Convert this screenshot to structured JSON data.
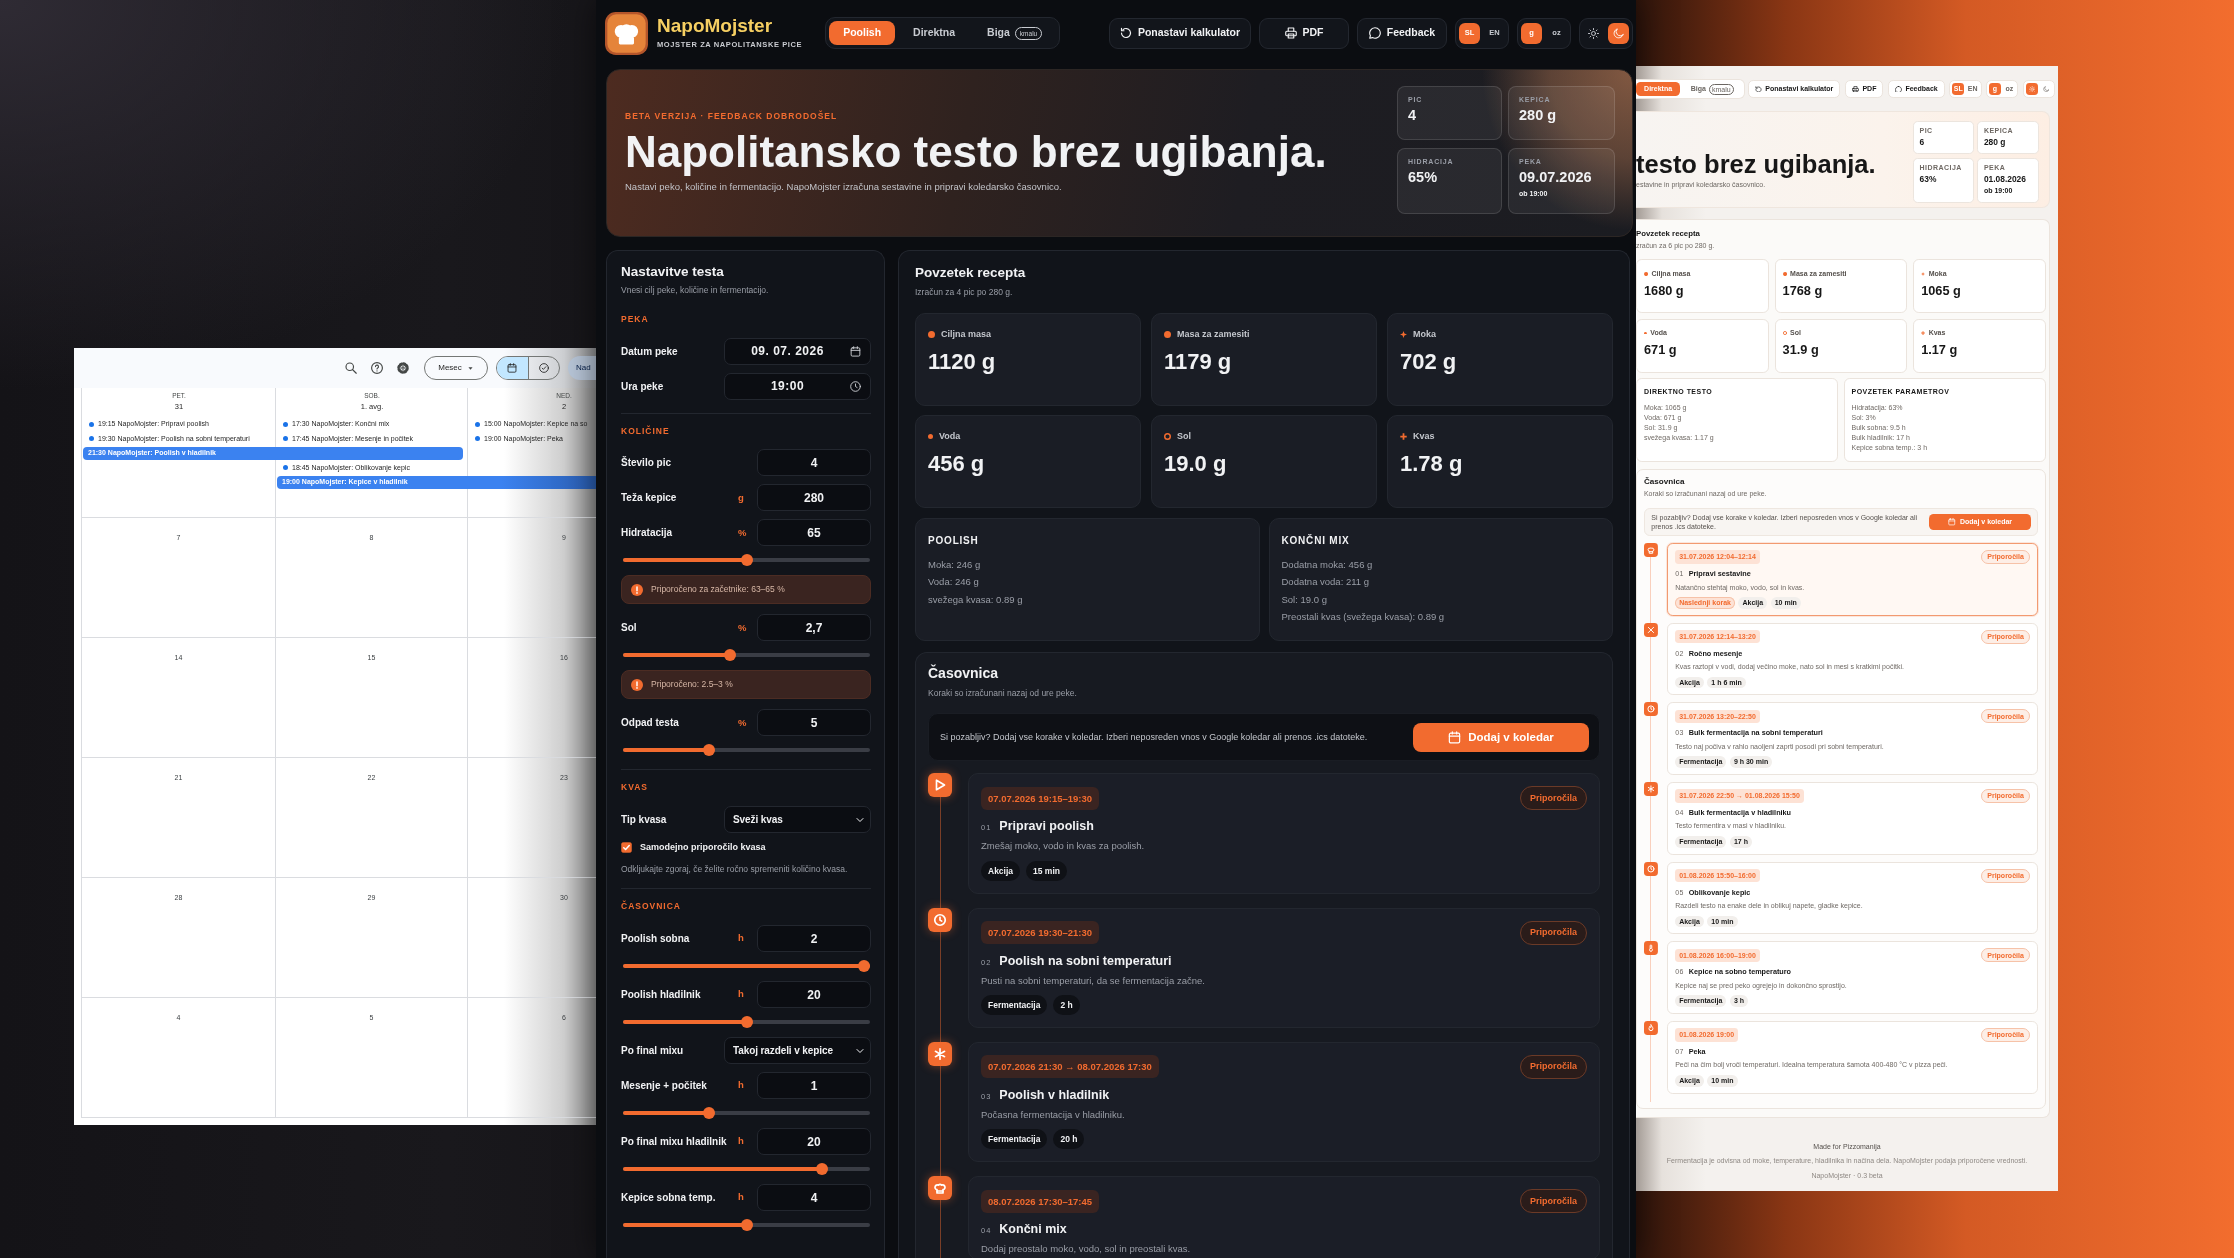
{
  "calendar": {
    "toolbar": {
      "view": "Mesec",
      "modes": [
        {
          "kind": "calendar",
          "selected": true
        },
        {
          "kind": "tasks",
          "selected": false
        }
      ],
      "account_button": "Nad"
    },
    "days": [
      {
        "weekday": "PET.",
        "date": "31",
        "events": [
          {
            "kind": "timed",
            "text": "19:15 NapoMojster: Pripravi poolish"
          },
          {
            "kind": "timed",
            "text": "19:30 NapoMojster: Poolish na sobni temperaturi"
          },
          {
            "kind": "overnight",
            "text": "21:30 NapoMojster: Poolish v hladilnik"
          }
        ]
      },
      {
        "weekday": "SOB.",
        "date": "1. avg.",
        "events": [
          {
            "kind": "timed",
            "text": "17:30 NapoMojster: Končni mix"
          },
          {
            "kind": "timed",
            "text": "17:45 NapoMojster: Mesenje in počitek"
          },
          {
            "kind": "timed",
            "text": "18:45 NapoMojster: Oblikovanje kepic"
          },
          {
            "kind": "overnight",
            "text": "19:00 NapoMojster: Kepice v hladilnik"
          }
        ]
      },
      {
        "weekday": "NED.",
        "date": "2",
        "events": [
          {
            "kind": "timed",
            "text": "15:00 NapoMojster: Kepice na so"
          },
          {
            "kind": "timed",
            "text": "19:00 NapoMojster: Peka"
          }
        ]
      }
    ],
    "weeks": [
      [
        "7",
        "8",
        "9"
      ],
      [
        "14",
        "15",
        "16"
      ],
      [
        "21",
        "22",
        "23"
      ],
      [
        "28",
        "29",
        "30"
      ],
      [
        "4",
        "5",
        "6"
      ]
    ]
  },
  "dark_app": {
    "brand": {
      "name": "NapoMojster",
      "tagline": "MOJSTER ZA NAPOLITANSKE PICE"
    },
    "method_tabs": [
      {
        "label": "Poolish",
        "selected": true
      },
      {
        "label": "Direktna",
        "selected": false
      },
      {
        "label": "Biga",
        "badge": "kmalu",
        "selected": false
      }
    ],
    "actions": [
      {
        "kind": "reset",
        "label": "Ponastavi kalkulator"
      },
      {
        "kind": "print",
        "label": "PDF"
      },
      {
        "kind": "feedback",
        "label": "Feedback"
      }
    ],
    "languages": [
      {
        "label": "SL",
        "selected": true
      },
      {
        "label": "EN",
        "selected": false
      }
    ],
    "units": [
      {
        "label": "g",
        "selected": true
      },
      {
        "label": "oz",
        "selected": false
      }
    ],
    "themes": [
      {
        "kind": "light",
        "selected": false
      },
      {
        "kind": "dark",
        "selected": true
      }
    ],
    "hero": {
      "eyebrow": "BETA VERZIJA · FEEDBACK DOBRODOŠEL",
      "title": "Napolitansko testo brez ugibanja.",
      "subtitle": "Nastavi peko, količine in fermentacijo. NapoMojster izračuna sestavine in pripravi koledarsko časovnico.",
      "stats": [
        {
          "label": "PIC",
          "value": "4"
        },
        {
          "label": "KEPICA",
          "value": "280 g"
        },
        {
          "label": "HIDRACIJA",
          "value": "65%"
        },
        {
          "label": "PEKA",
          "value": "09.07.2026",
          "note": "ob 19:00"
        }
      ]
    },
    "settings": {
      "title": "Nastavitve testa",
      "subtitle": "Vnesi cilj peke, količine in fermentacijo.",
      "sections": [
        {
          "heading": "PEKA",
          "items": [
            {
              "kind": "date",
              "label": "Datum peke",
              "value": "09. 07. 2026"
            },
            {
              "kind": "time",
              "label": "Ura peke",
              "value": "19:00"
            }
          ]
        },
        {
          "heading": "KOLIČINE",
          "items": [
            {
              "kind": "number",
              "label": "Število pic",
              "value": "4"
            },
            {
              "kind": "number",
              "label": "Teža kepice",
              "unit": "g",
              "value": "280"
            },
            {
              "kind": "number",
              "label": "Hidratacija",
              "unit": "%",
              "value": "65",
              "level": 0.5
            },
            {
              "kind": "note",
              "text": "Priporočeno za začetnike: 63–65 %"
            },
            {
              "kind": "number",
              "label": "Sol",
              "unit": "%",
              "value": "2,7",
              "level": 0.43
            },
            {
              "kind": "note",
              "text": "Priporočeno: 2.5–3 %"
            },
            {
              "kind": "number",
              "label": "Odpad testa",
              "unit": "%",
              "value": "5",
              "level": 0.34
            }
          ]
        },
        {
          "heading": "KVAS",
          "items": [
            {
              "kind": "select",
              "label": "Tip kvasa",
              "value": "Sveži kvas"
            },
            {
              "kind": "checkbox",
              "label": "Samodejno priporočilo kvasa",
              "checked": true
            },
            {
              "kind": "help",
              "text": "Odkljukajte zgoraj, če želite ročno spremeniti količino kvasa."
            }
          ]
        },
        {
          "heading": "ČASOVNICA",
          "items": [
            {
              "kind": "number",
              "label": "Poolish sobna",
              "unit": "h",
              "value": "2",
              "level": 1
            },
            {
              "kind": "number",
              "label": "Poolish hladilnik",
              "unit": "h",
              "value": "20",
              "level": 0.5
            },
            {
              "kind": "select",
              "label": "Po final mixu",
              "value": "Takoj razdeli v kepice"
            },
            {
              "kind": "number",
              "label": "Mesenje + počitek",
              "unit": "h",
              "value": "1",
              "level": 0.34
            },
            {
              "kind": "number",
              "label": "Po final mixu hladilnik",
              "unit": "h",
              "value": "20",
              "level": 0.82
            },
            {
              "kind": "number",
              "label": "Kepice sobna temp.",
              "unit": "h",
              "value": "4",
              "level": 0.5
            }
          ]
        }
      ]
    },
    "summary": {
      "title": "Povzetek recepta",
      "subtitle": "Izračun za 4 pic po 280 g.",
      "tiles": [
        {
          "kind": "target",
          "label": "Ciljna masa",
          "value": "1120 g"
        },
        {
          "kind": "dough",
          "label": "Masa za zamesiti",
          "value": "1179 g"
        },
        {
          "kind": "flour",
          "label": "Moka",
          "value": "702 g"
        },
        {
          "kind": "water",
          "label": "Voda",
          "value": "456 g"
        },
        {
          "kind": "salt",
          "label": "Sol",
          "value": "19.0 g"
        },
        {
          "kind": "yeast",
          "label": "Kvas",
          "value": "1.78 g"
        }
      ],
      "parts": [
        {
          "title": "POOLISH",
          "lines": [
            "Moka: 246 g",
            "Voda: 246 g",
            "svežega kvasa: 0.89 g"
          ]
        },
        {
          "title": "KONČNI MIX",
          "lines": [
            "Dodatna moka: 456 g",
            "Dodatna voda: 211 g",
            "Sol: 19.0 g",
            "Preostali kvas (svežega kvasa): 0.89 g"
          ]
        }
      ]
    },
    "timeline": {
      "title": "Časovnica",
      "subtitle": "Koraki so izračunani nazaj od ure peke.",
      "banner": "Si pozabljiv? Dodaj vse korake v koledar. Izberi neposreden vnos v Google koledar ali prenos .ics datoteke.",
      "button": "Dodaj v koledar",
      "steps": [
        {
          "kind": "start",
          "time": "07.07.2026 19:15–19:30",
          "number": "01",
          "title": "Pripravi poolish",
          "description": "Zmešaj moko, vodo in kvas za poolish.",
          "tags": [
            "Akcija",
            "15 min"
          ],
          "tip": "Priporočila",
          "current": false
        },
        {
          "kind": "clock",
          "time": "07.07.2026 19:30–21:30",
          "number": "02",
          "title": "Poolish na sobni temperaturi",
          "description": "Pusti na sobni temperaturi, da se fermentacija začne.",
          "tags": [
            "Fermentacija",
            "2 h"
          ],
          "tip": "Priporočila",
          "current": false
        },
        {
          "kind": "cold",
          "time": "07.07.2026 21:30 → 08.07.2026 17:30",
          "number": "03",
          "title": "Poolish v hladilnik",
          "description": "Počasna fermentacija v hladilniku.",
          "tags": [
            "Fermentacija",
            "20 h"
          ],
          "tip": "Priporočila",
          "current": false
        },
        {
          "kind": "mix",
          "time": "08.07.2026 17:30–17:45",
          "number": "04",
          "title": "Končni mix",
          "description": "Dodaj preostalo moko, vodo, sol in preostali kvas.",
          "tip": "Priporočila",
          "current": false
        }
      ]
    }
  },
  "light_app": {
    "method_tabs": [
      {
        "label": "Direktna",
        "selected": true
      },
      {
        "label": "Biga",
        "badge": "kmalu",
        "selected": false
      }
    ],
    "actions": [
      {
        "kind": "reset",
        "label": "Ponastavi kalkulator"
      },
      {
        "kind": "print",
        "label": "PDF"
      },
      {
        "kind": "feedback",
        "label": "Feedback"
      }
    ],
    "languages": [
      {
        "label": "SL",
        "selected": true
      },
      {
        "label": "EN",
        "selected": false
      }
    ],
    "units": [
      {
        "label": "g",
        "selected": true
      },
      {
        "label": "oz",
        "selected": false
      }
    ],
    "themes": [
      {
        "kind": "light",
        "selected": true
      },
      {
        "kind": "dark",
        "selected": false
      }
    ],
    "hero": {
      "title": "testo brez ugibanja.",
      "subtitle": "estavine in pripravi koledarsko časovnico.",
      "stats": [
        {
          "label": "PIC",
          "value": "6"
        },
        {
          "label": "KEPICA",
          "value": "280 g"
        },
        {
          "label": "HIDRACIJA",
          "value": "63%"
        },
        {
          "label": "PEKA",
          "value": "01.08.2026",
          "note": "ob 19:00"
        }
      ]
    },
    "summary": {
      "title": "Povzetek recepta",
      "subtitle": "zračun za 6 pic po 280 g.",
      "tiles": [
        {
          "kind": "target",
          "label": "Ciljna masa",
          "value": "1680 g"
        },
        {
          "kind": "dough",
          "label": "Masa za zamesiti",
          "value": "1768 g"
        },
        {
          "kind": "flour",
          "label": "Moka",
          "value": "1065 g"
        },
        {
          "kind": "water",
          "label": "Voda",
          "value": "671 g"
        },
        {
          "kind": "salt",
          "label": "Sol",
          "value": "31.9 g"
        },
        {
          "kind": "yeast",
          "label": "Kvas",
          "value": "1.17 g"
        }
      ],
      "parts": [
        {
          "title": "DIREKTNO TESTO",
          "lines": [
            "Moka: 1065 g",
            "Voda: 671 g",
            "Sol: 31.9 g",
            "svežega kvasa: 1.17 g"
          ]
        },
        {
          "title": "POVZETEK PARAMETROV",
          "lines": [
            "Hidratacija: 63%",
            "Sol: 3%",
            "Bulk sobna: 9.5 h",
            "Bulk hladilnik: 17 h",
            "Kepice sobna temp.: 3 h"
          ]
        }
      ]
    },
    "timeline": {
      "title": "Časovnica",
      "subtitle": "Koraki so izračunani nazaj od ure peke.",
      "banner": "Si pozabljiv? Dodaj vse korake v koledar. Izberi neposreden vnos v Google koledar ali prenos .ics datoteke.",
      "button": "Dodaj v koledar",
      "steps": [
        {
          "kind": "mix",
          "time": "31.07.2026 12:04–12:14",
          "number": "01",
          "title": "Pripravi sestavine",
          "description": "Natančno stehtaj moko, vodo, sol in kvas.",
          "next_label": "Naslednji korak",
          "tags": [
            "Akcija",
            "10 min"
          ],
          "tip": "Priporočila",
          "current": true
        },
        {
          "kind": "knead",
          "time": "31.07.2026 12:14–13:20",
          "number": "02",
          "title": "Ročno mesenje",
          "description": "Kvas raztopi v vodi, dodaj večino moke, nato sol in mesi s kratkimi počitki.",
          "tags": [
            "Akcija",
            "1 h 6 min"
          ],
          "tip": "Priporočila",
          "current": false
        },
        {
          "kind": "clock",
          "time": "31.07.2026 13:20–22:50",
          "number": "03",
          "title": "Bulk fermentacija na sobni temperaturi",
          "description": "Testo naj počiva v rahlo naoljeni zaprti posodi pri sobni temperaturi.",
          "tags": [
            "Fermentacija",
            "9 h 30 min"
          ],
          "tip": "Priporočila",
          "current": false
        },
        {
          "kind": "cold",
          "time": "31.07.2026 22:50 → 01.08.2026 15:50",
          "number": "04",
          "title": "Bulk fermentacija v hladilniku",
          "description": "Testo fermentira v masi v hladilniku.",
          "tags": [
            "Fermentacija",
            "17 h"
          ],
          "tip": "Priporočila",
          "current": false
        },
        {
          "kind": "clock",
          "time": "01.08.2026 15:50–16:00",
          "number": "05",
          "title": "Oblikovanje kepic",
          "description": "Razdeli testo na enake dele in oblikuj napete, gladke kepice.",
          "tags": [
            "Akcija",
            "10 min"
          ],
          "tip": "Priporočila",
          "current": false
        },
        {
          "kind": "thermo",
          "time": "01.08.2026 16:00–19:00",
          "number": "06",
          "title": "Kepice na sobno temperaturo",
          "description": "Kepice naj se pred peko ogrejejo in dokončno sprostijo.",
          "tags": [
            "Fermentacija",
            "3 h"
          ],
          "tip": "Priporočila",
          "current": false
        },
        {
          "kind": "flame",
          "time": "01.08.2026 19:00",
          "number": "07",
          "title": "Peka",
          "description": "Peči na čim bolj vroči temperaturi. Idealna temperatura šamota 400-480 °C v pizza peči.",
          "tags": [
            "Akcija",
            "10 min"
          ],
          "tip": "Priporočila",
          "current": false
        }
      ]
    },
    "footer": {
      "credit": "Made for Pizzomanija",
      "note": "Fermentacija je odvisna od moke, temperature, hladilnika in načina dela. NapoMojster podaja priporočene vrednosti.",
      "version": "NapoMojster · 0.3 beta"
    }
  }
}
